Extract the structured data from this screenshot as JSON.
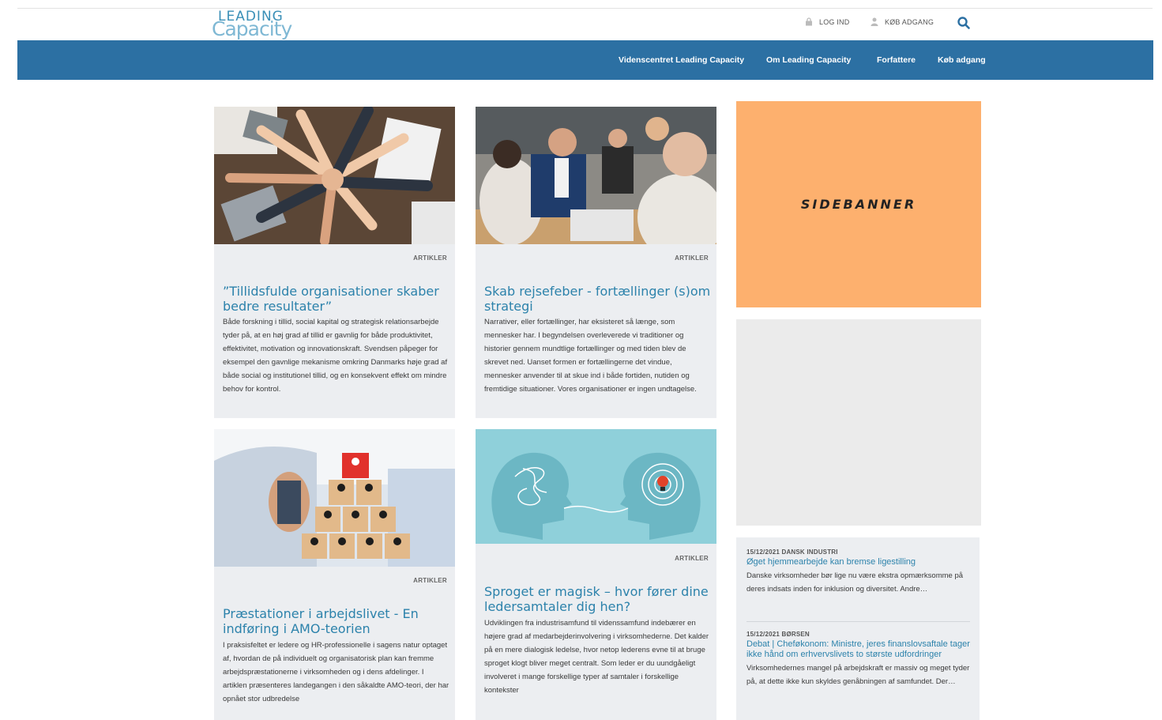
{
  "header": {
    "logo_top": "LEADING",
    "logo_bottom": "Capacity",
    "login_label": "LOG IND",
    "buy_label": "KØB ADGANG"
  },
  "nav": {
    "items": [
      "Videnscentret Leading Capacity",
      "Om Leading Capacity",
      "Forfattere",
      "Køb adgang"
    ]
  },
  "articles": [
    {
      "tag": "ARTIKLER",
      "title": "”Tillidsfulde organisationer skaber bedre resultater”",
      "excerpt": "Både forskning i tillid, social kapital og strategisk relationsarbejde tyder på, at en høj grad af tillid er gavnlig for både produktivitet, effektivitet, motivation og innovationskraft. Svendsen påpeger for eksempel den gavnlige mekanisme omkring Danmarks høje grad af både social og institutionel tillid, og en konsekvent effekt om mindre behov for kontrol."
    },
    {
      "tag": "ARTIKLER",
      "title": "Skab rejsefeber - fortællinger (s)om strategi",
      "excerpt": "Narrativer, eller fortællinger, har eksisteret så længe, som mennesker har. I begyndelsen overleverede vi traditioner og historier gennem mundtlige fortællinger og med tiden blev de skrevet ned. Uanset formen er fortællingerne det vindue, mennesker anvender til at skue ind i både fortiden, nutiden og fremtidige situationer. Vores organisationer er ingen undtagelse."
    },
    {
      "tag": "ARTIKLER",
      "title": "Præstationer i arbejdslivet - En indføring i AMO-teorien",
      "excerpt": "I praksisfeltet er ledere og HR-professionelle i sagens natur optaget af, hvordan de på individuelt og organisatorisk plan kan fremme arbejdspræstationerne i virksomheden og i dens afdelinger. I artiklen præsenteres landegangen i den såkaldte AMO-teori, der har opnået stor udbredelse"
    },
    {
      "tag": "ARTIKLER",
      "title": "Sproget er magisk – hvor fører dine ledersamtaler dig hen?",
      "excerpt": "Udviklingen fra industrisamfund til videnssamfund indebærer en højere grad af medarbejderinvolvering i virksomhederne. Det kalder på en mere dialogisk ledelse, hvor netop lederens evne til at bruge sproget klogt bliver meget centralt. Som leder er du uundgåeligt involveret i mange forskellige typer af samtaler i forskellige kontekster"
    }
  ],
  "sidebar": {
    "banner_label": "SIDEBANNER",
    "news": [
      {
        "meta": "15/12/2021 DANSK INDUSTRI",
        "title": "Øget hjemmearbejde kan bremse ligestilling",
        "text": "Danske virksomheder bør lige nu være ekstra opmærksomme på deres indsats inden for inklusion og diversitet. Andre…"
      },
      {
        "meta": "15/12/2021 BØRSEN",
        "title": "Debat | Cheføkonom: Ministre, jeres finanslovsaftale tager ikke hånd om erhvervslivets to største udfordringer",
        "text": "Virksomhedernes mangel på arbejdskraft er massiv og meget tyder på, at dette ikke kun skyldes genåbningen af samfundet. Der…"
      }
    ]
  }
}
